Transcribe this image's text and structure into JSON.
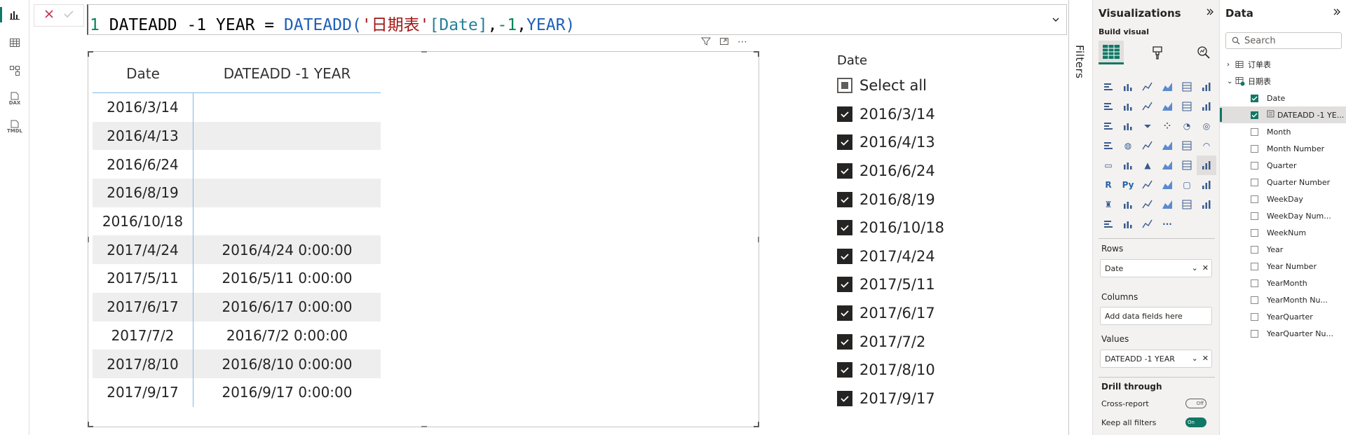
{
  "formula": {
    "line_no": "1",
    "measure_name": "DATEADD -1 YEAR",
    "equals": "=",
    "fn": "DATEADD",
    "open": "(",
    "table": "'日期表'",
    "column": "[Date]",
    "comma1": ",",
    "offset": "-1",
    "comma2": ",",
    "interval": "YEAR",
    "close": ")"
  },
  "table_visual": {
    "columns": [
      "Date",
      "DATEADD -1 YEAR"
    ],
    "rows": [
      [
        "2016/3/14",
        ""
      ],
      [
        "2016/4/13",
        ""
      ],
      [
        "2016/6/24",
        ""
      ],
      [
        "2016/8/19",
        ""
      ],
      [
        "2016/10/18",
        ""
      ],
      [
        "2017/4/24",
        "2016/4/24 0:00:00"
      ],
      [
        "2017/5/11",
        "2016/5/11 0:00:00"
      ],
      [
        "2017/6/17",
        "2016/6/17 0:00:00"
      ],
      [
        "2017/7/2",
        "2016/7/2 0:00:00"
      ],
      [
        "2017/8/10",
        "2016/8/10 0:00:00"
      ],
      [
        "2017/9/17",
        "2016/9/17 0:00:00"
      ]
    ]
  },
  "slicer": {
    "title": "Date",
    "select_all": "Select all",
    "items": [
      "2016/3/14",
      "2016/4/13",
      "2016/6/24",
      "2016/8/19",
      "2016/10/18",
      "2017/4/24",
      "2017/5/11",
      "2017/6/17",
      "2017/7/2",
      "2017/8/10",
      "2017/9/17"
    ]
  },
  "filters": {
    "label": "Filters"
  },
  "rail": {
    "dax_label": "DAX",
    "tmdl_label": "TMDL"
  },
  "visualizations": {
    "title": "Visualizations",
    "build_visual": "Build visual",
    "rows_label": "Rows",
    "rows_field": "Date",
    "columns_label": "Columns",
    "columns_placeholder": "Add data fields here",
    "values_label": "Values",
    "values_field": "DATEADD -1 YEAR",
    "drill_through": "Drill through",
    "cross_report": "Cross-report",
    "cross_report_state": "Off",
    "keep_all_filters": "Keep all filters",
    "keep_all_filters_state": "On",
    "more": "···"
  },
  "data_pane": {
    "title": "Data",
    "search_placeholder": "Search",
    "tables": [
      "订单表",
      "日期表"
    ],
    "fields": [
      {
        "name": "Date",
        "checked": true
      },
      {
        "name": "DATEADD -1 YE...",
        "checked": true
      },
      {
        "name": "Month",
        "checked": false
      },
      {
        "name": "Month Number",
        "checked": false
      },
      {
        "name": "Quarter",
        "checked": false
      },
      {
        "name": "Quarter Number",
        "checked": false
      },
      {
        "name": "WeekDay",
        "checked": false
      },
      {
        "name": "WeekDay Num...",
        "checked": false
      },
      {
        "name": "WeekNum",
        "checked": false
      },
      {
        "name": "Year",
        "checked": false
      },
      {
        "name": "Year Number",
        "checked": false
      },
      {
        "name": "YearMonth",
        "checked": false
      },
      {
        "name": "YearMonth Nu...",
        "checked": false
      },
      {
        "name": "YearQuarter",
        "checked": false
      },
      {
        "name": "YearQuarter Nu...",
        "checked": false
      }
    ]
  },
  "colors": {
    "accent": "#117865",
    "grid_line": "#7fb9e6",
    "alt_row": "#eeeeee"
  }
}
